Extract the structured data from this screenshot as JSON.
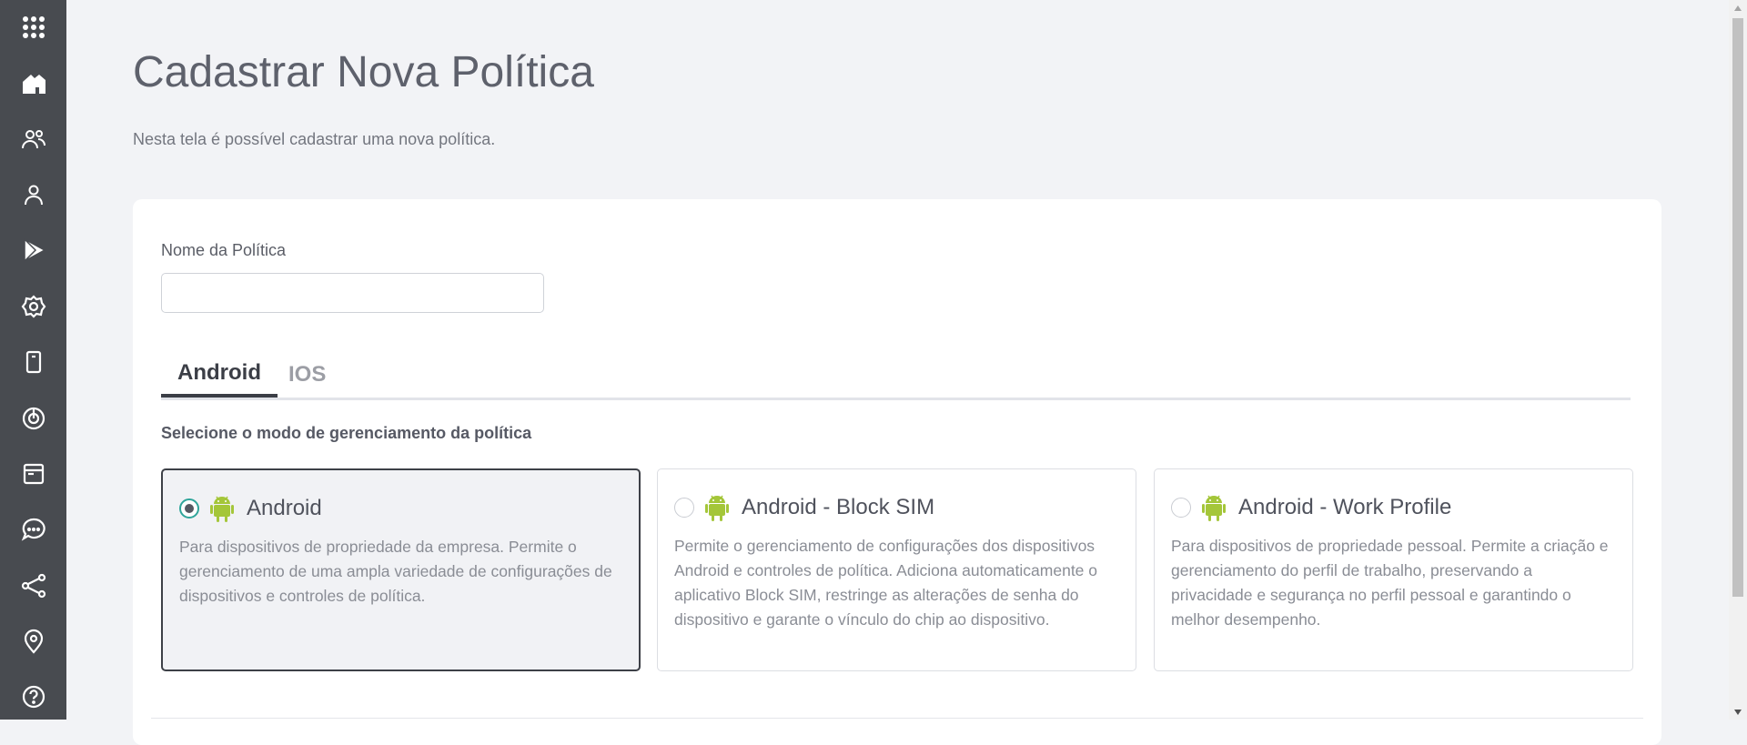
{
  "sidebar": {
    "items": [
      {
        "icon": "apps-grid-icon",
        "label": ""
      },
      {
        "icon": "home-icon",
        "label": ""
      },
      {
        "icon": "users-icon",
        "label": ""
      },
      {
        "icon": "user-icon",
        "label": ""
      },
      {
        "icon": "play-store-icon",
        "label": ""
      },
      {
        "icon": "settings-icon",
        "label": ""
      },
      {
        "icon": "device-icon",
        "label": ""
      },
      {
        "icon": "radar-icon",
        "label": ""
      },
      {
        "icon": "browser-window-icon",
        "label": ""
      },
      {
        "icon": "chat-icon",
        "label": ""
      },
      {
        "icon": "share-icon",
        "label": ""
      },
      {
        "icon": "location-icon",
        "label": ""
      },
      {
        "icon": "help-icon",
        "label": ""
      }
    ]
  },
  "page": {
    "title": "Cadastrar Nova Política",
    "subtitle": "Nesta tela é possível cadastrar uma nova política."
  },
  "form": {
    "name_label": "Nome da Política",
    "name_value": "",
    "name_placeholder": ""
  },
  "tabs": [
    {
      "label": "Android",
      "active": true
    },
    {
      "label": "IOS",
      "active": false
    }
  ],
  "mode_section": {
    "label": "Selecione o modo de gerenciamento da política",
    "options": [
      {
        "title": "Android",
        "description": "Para dispositivos de propriedade da empresa. Permite o gerenciamento de uma ampla variedade de configurações de dispositivos e controles de política.",
        "selected": true
      },
      {
        "title": "Android - Block SIM",
        "description": "Permite o gerenciamento de configurações dos dispositivos Android e controles de política. Adiciona automaticamente o aplicativo Block SIM, restringe as alterações de senha do dispositivo e garante o vínculo do chip ao dispositivo.",
        "selected": false
      },
      {
        "title": "Android - Work Profile",
        "description": "Para dispositivos de propriedade pessoal. Permite a criação e gerenciamento do perfil de trabalho, preservando a privacidade e segurança no perfil pessoal e garantindo o melhor desempenho.",
        "selected": false
      }
    ]
  },
  "colors": {
    "sidebar": "#484b50",
    "background": "#f2f3f6",
    "card": "#ffffff",
    "android_green": "#a4c639",
    "radio_accent": "#2fa59a",
    "active_tab": "#3b3e46",
    "inactive_tab": "#9c9ea5"
  }
}
